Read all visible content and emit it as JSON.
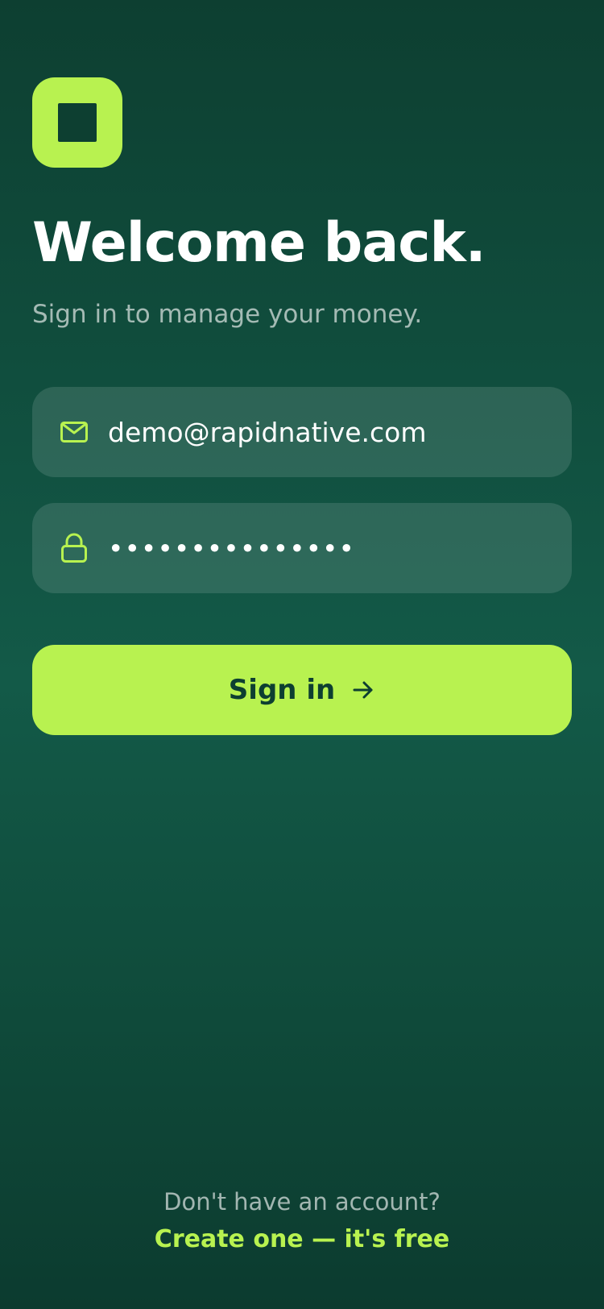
{
  "header": {
    "title": "Welcome back.",
    "subtitle": "Sign in to manage your money."
  },
  "form": {
    "email": {
      "value": "demo@rapidnative.com",
      "icon": "mail-icon"
    },
    "password": {
      "value": "•••••••••••••••",
      "icon": "lock-icon"
    },
    "submit_label": "Sign in",
    "submit_icon": "arrow-right-icon"
  },
  "footer": {
    "prompt": "Don't have an account?",
    "link_label": "Create one — it's free"
  },
  "colors": {
    "accent": "#b8f250",
    "background": "#0d3f31",
    "field_background": "rgba(255,255,255,0.12)"
  }
}
